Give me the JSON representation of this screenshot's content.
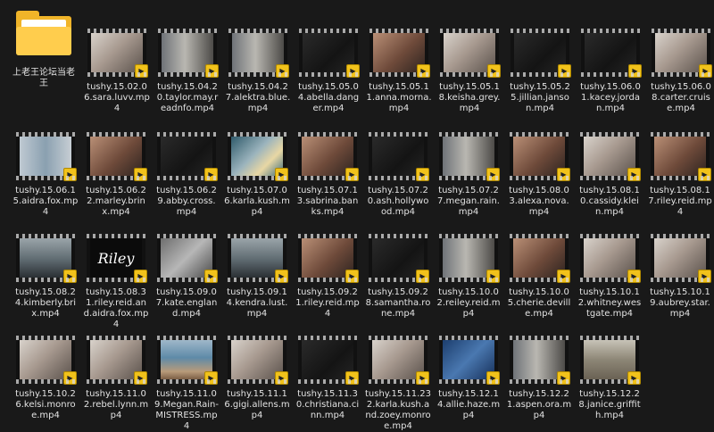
{
  "window": {
    "background": "#191919"
  },
  "folder": {
    "name": "上老王论坛当老王"
  },
  "files": [
    {
      "name": "tushy.15.02.06.sara.luvv.mp4",
      "scene": "light"
    },
    {
      "name": "tushy.15.04.20.taylor.may.readnfo.mp4",
      "scene": "room"
    },
    {
      "name": "tushy.15.04.27.alektra.blue.mp4",
      "scene": "room"
    },
    {
      "name": "tushy.15.05.04.abella.danger.mp4",
      "scene": "dark"
    },
    {
      "name": "tushy.15.05.11.anna.morna.mp4",
      "scene": "warm"
    },
    {
      "name": "tushy.15.05.18.keisha.grey.mp4",
      "scene": "light"
    },
    {
      "name": "tushy.15.05.25.jillian.janson.mp4",
      "scene": "dark"
    },
    {
      "name": "tushy.15.06.01.kacey.jordan.mp4",
      "scene": "dark"
    },
    {
      "name": "tushy.15.06.08.carter.cruise.mp4",
      "scene": "light"
    },
    {
      "name": "tushy.15.06.15.aidra.fox.mp4",
      "scene": "window"
    },
    {
      "name": "tushy.15.06.22.marley.brinx.mp4",
      "scene": "warm"
    },
    {
      "name": "tushy.15.06.29.abby.cross.mp4",
      "scene": "dark"
    },
    {
      "name": "tushy.15.07.06.karla.kush.mp4",
      "scene": "teal"
    },
    {
      "name": "tushy.15.07.13.sabrina.banks.mp4",
      "scene": "warm"
    },
    {
      "name": "tushy.15.07.20.ash.hollywood.mp4",
      "scene": "dark"
    },
    {
      "name": "tushy.15.07.27.megan.rain.mp4",
      "scene": "room"
    },
    {
      "name": "tushy.15.08.03.alexa.nova.mp4",
      "scene": "warm"
    },
    {
      "name": "tushy.15.08.10.cassidy.klein.mp4",
      "scene": "light"
    },
    {
      "name": "tushy.15.08.17.riley.reid.mp4",
      "scene": "warm"
    },
    {
      "name": "tushy.15.08.24.kimberly.brix.mp4",
      "scene": "car"
    },
    {
      "name": "tushy.15.08.31.riley.reid.and.aidra.fox.mp4",
      "scene": "riley",
      "overlay": "Riley"
    },
    {
      "name": "tushy.15.09.07.kate.england.mp4",
      "scene": "gray"
    },
    {
      "name": "tushy.15.09.14.kendra.lust.mp4",
      "scene": "car"
    },
    {
      "name": "tushy.15.09.21.riley.reid.mp4",
      "scene": "warm"
    },
    {
      "name": "tushy.15.09.28.samantha.rone.mp4",
      "scene": "dark"
    },
    {
      "name": "tushy.15.10.02.reiley.reid.mp4",
      "scene": "room"
    },
    {
      "name": "tushy.15.10.05.cherie.deville.mp4",
      "scene": "warm"
    },
    {
      "name": "tushy.15.10.12.whitney.westgate.mp4",
      "scene": "light"
    },
    {
      "name": "tushy.15.10.19.aubrey.star.mp4",
      "scene": "light"
    },
    {
      "name": "tushy.15.10.26.kelsi.monroe.mp4",
      "scene": "light"
    },
    {
      "name": "tushy.15.11.02.rebel.lynn.mp4",
      "scene": "light"
    },
    {
      "name": "tushy.15.11.09.Megan.Rain-MISTRESS.mp4",
      "scene": "sea"
    },
    {
      "name": "tushy.15.11.16.gigi.allens.mp4",
      "scene": "light"
    },
    {
      "name": "tushy.15.11.30.christiana.cinn.mp4",
      "scene": "dark"
    },
    {
      "name": "tushy.15.11.232.karla.kush.and.zoey.monroe.mp4",
      "scene": "light"
    },
    {
      "name": "tushy.15.12.14.allie.haze.mp4",
      "scene": "blue"
    },
    {
      "name": "tushy.15.12.21.aspen.ora.mp4",
      "scene": "room"
    },
    {
      "name": "tushy.15.12.28.janice.griffith.mp4",
      "scene": "tree"
    }
  ],
  "badge_icon": "player-icon",
  "badge_text": "▶",
  "colors": {
    "folder_yellow": "#f0b429",
    "badge_yellow": "#f1c21b",
    "text": "#e3e3e3"
  }
}
